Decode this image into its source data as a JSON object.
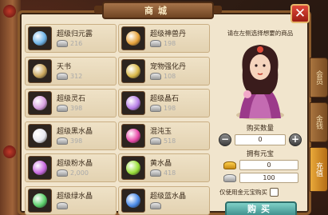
{
  "shop": {
    "title": "商城",
    "close_label": "✕"
  },
  "items": [
    {
      "name": "超级归元露",
      "price": "216",
      "icon": "blue-potion-icon",
      "color": "#6fb4e8"
    },
    {
      "name": "超级神兽丹",
      "price": "198",
      "icon": "beast-pill-icon",
      "color": "#e8a33b"
    },
    {
      "name": "天书",
      "price": "312",
      "icon": "book-icon",
      "color": "#c9a65c"
    },
    {
      "name": "宠物强化丹",
      "price": "108",
      "icon": "pet-pill-icon",
      "color": "#d9b84a"
    },
    {
      "name": "超级灵石",
      "price": "398",
      "icon": "spirit-stone-icon",
      "color": "#d8a0e0"
    },
    {
      "name": "超级晶石",
      "price": "198",
      "icon": "crystal-stone-icon",
      "color": "#b880e8"
    },
    {
      "name": "超级黑水晶",
      "price": "398",
      "icon": "black-crystal-icon",
      "color": "#e8e8f0"
    },
    {
      "name": "混沌玉",
      "price": "518",
      "icon": "chaos-jade-icon",
      "color": "#e84aa8"
    },
    {
      "name": "超级粉水晶",
      "price": "2,000",
      "icon": "pink-crystal-icon",
      "color": "#c86ae0"
    },
    {
      "name": "黄水晶",
      "price": "418",
      "icon": "yellow-crystal-icon",
      "color": "#9adf3a"
    },
    {
      "name": "超级绿水晶",
      "price": "",
      "icon": "green-crystal-icon",
      "color": "#5ad06a"
    },
    {
      "name": "超级蓝水晶",
      "price": "",
      "icon": "blue-crystal-icon",
      "color": "#4a8ae8"
    }
  ],
  "detail": {
    "hint": "请在左侧选择想要的商品",
    "quantity_label": "购买数量",
    "quantity_value": "0",
    "minus_label": "−",
    "plus_label": "+",
    "owned_label": "拥有元宝",
    "gold_value": "0",
    "silver_value": "100",
    "gold_only_label": "仅使用金元宝购买",
    "buy_label": "购买"
  },
  "side_tabs": [
    {
      "label": "会员",
      "active": false
    },
    {
      "label": "金钱",
      "active": false
    },
    {
      "label": "充值",
      "active": true
    }
  ]
}
